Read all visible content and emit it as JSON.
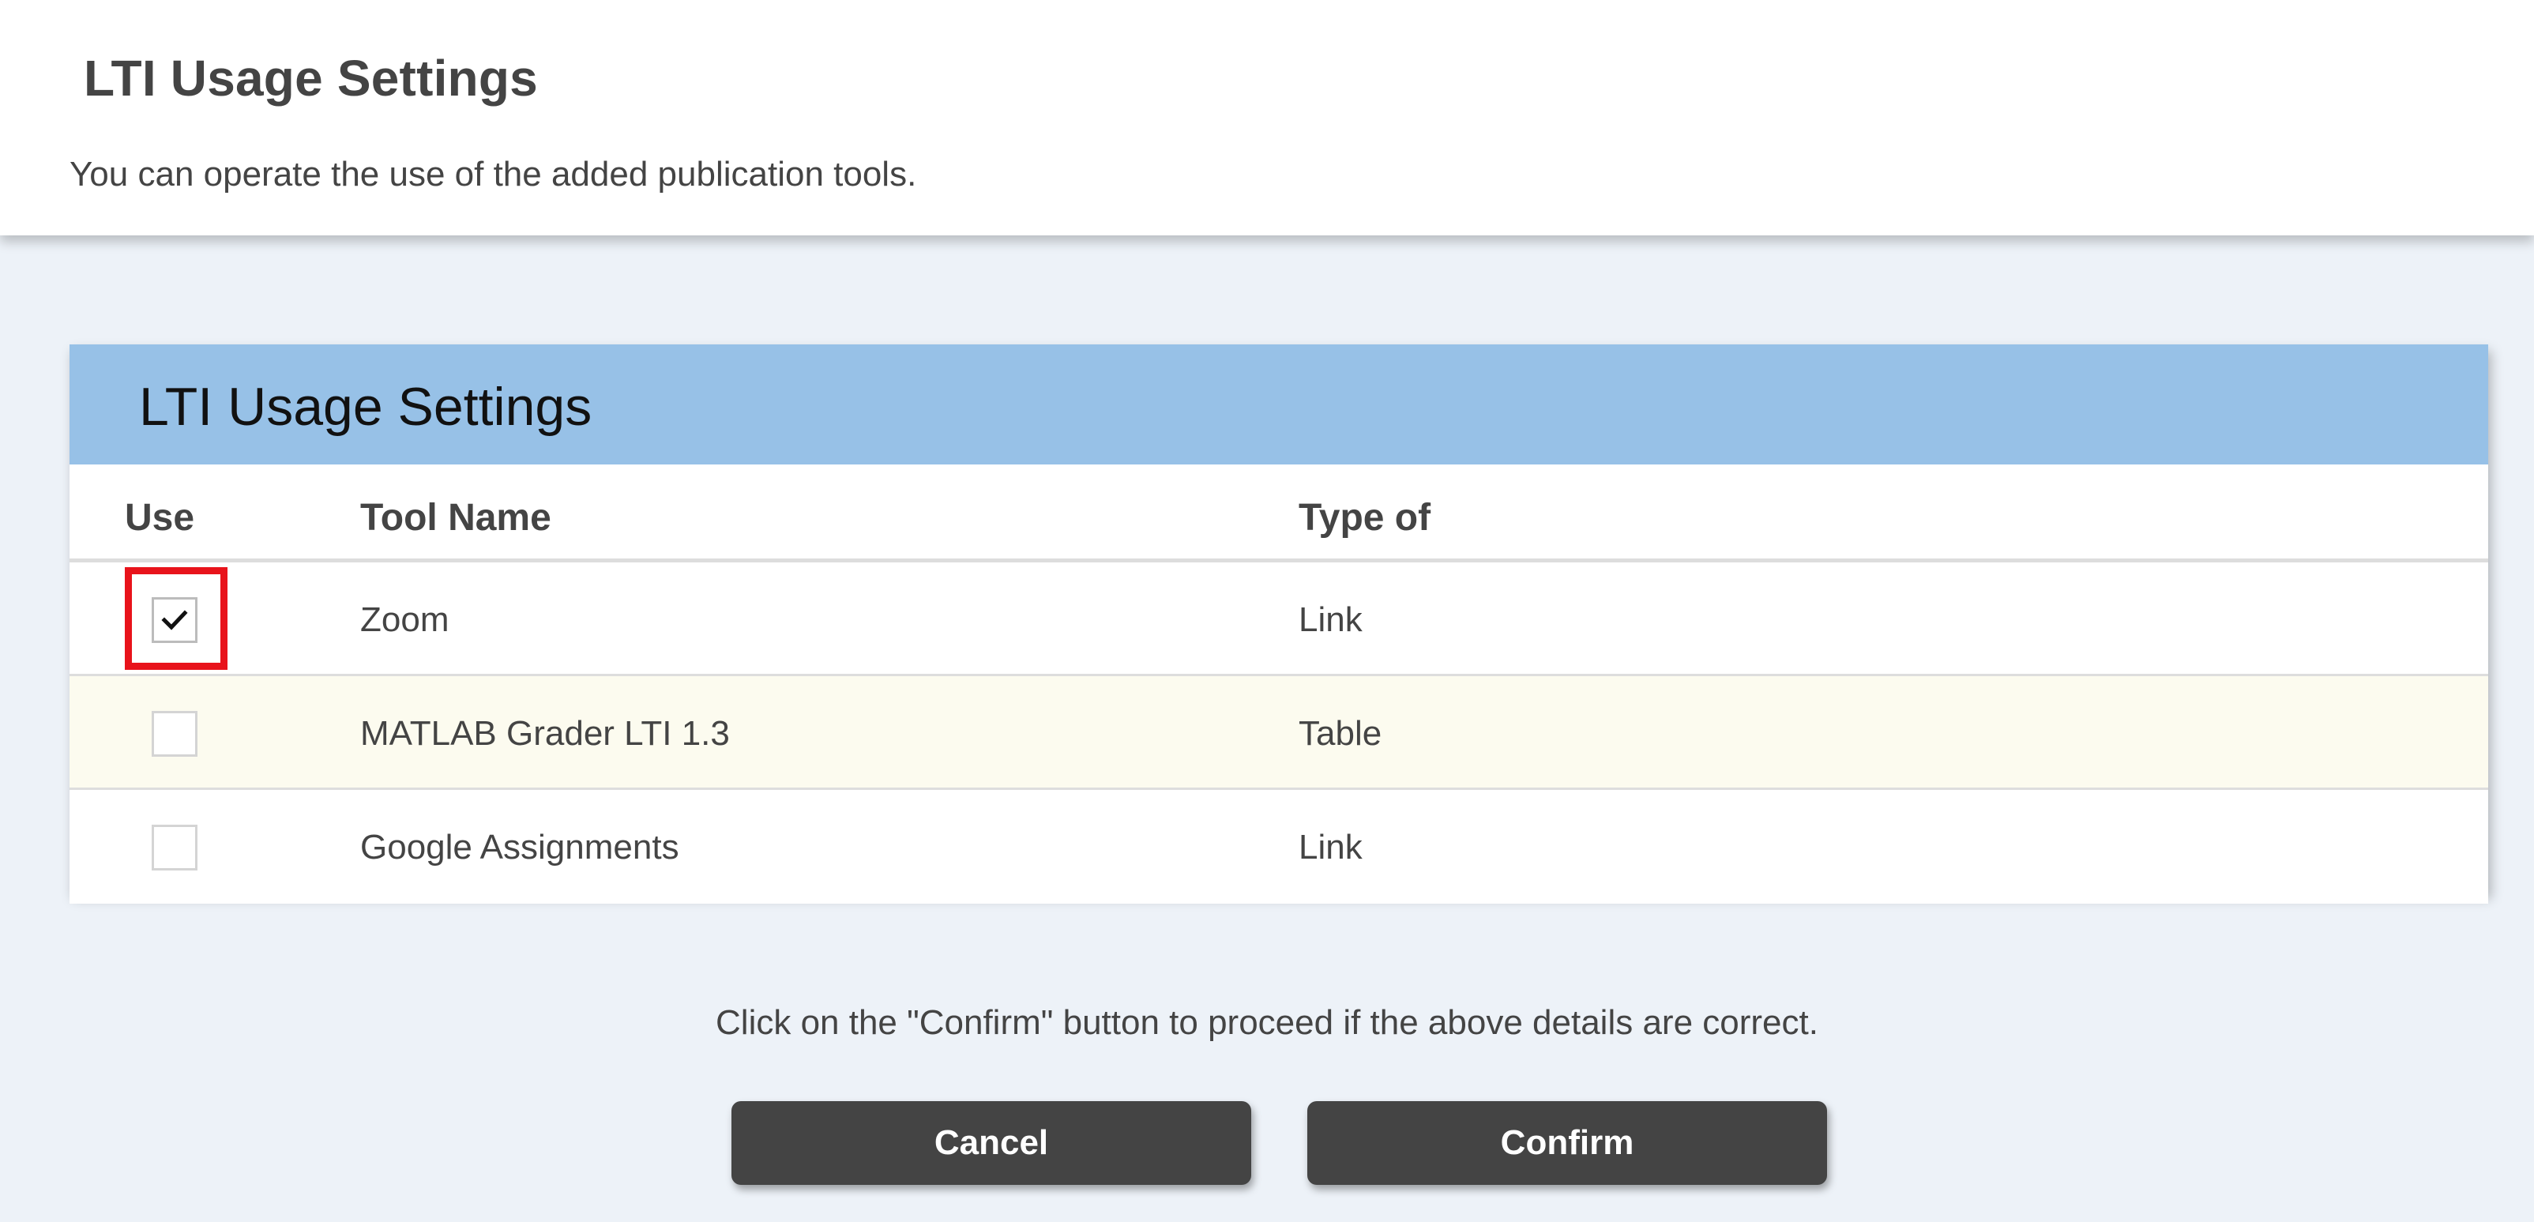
{
  "header": {
    "title": "LTI Usage Settings",
    "subtitle": "You can operate the use of the added publication tools."
  },
  "panel": {
    "title": "LTI Usage Settings",
    "columns": {
      "use": "Use",
      "tool_name": "Tool Name",
      "type": "Type of"
    },
    "rows": [
      {
        "checked": true,
        "tool_name": "Zoom",
        "type": "Link"
      },
      {
        "checked": false,
        "tool_name": "MATLAB Grader LTI 1.3",
        "type": "Table"
      },
      {
        "checked": false,
        "tool_name": "Google Assignments",
        "type": "Link"
      }
    ]
  },
  "footer": {
    "note": "Click on the \"Confirm\" button to proceed if the above details are correct.",
    "cancel_label": "Cancel",
    "confirm_label": "Confirm"
  },
  "colors": {
    "panel_header": "#97c1e7",
    "page_background": "#edf2f8",
    "highlight": "#e8131b",
    "button": "#444444"
  },
  "icons": {
    "checkbox_checked": "check-icon"
  }
}
